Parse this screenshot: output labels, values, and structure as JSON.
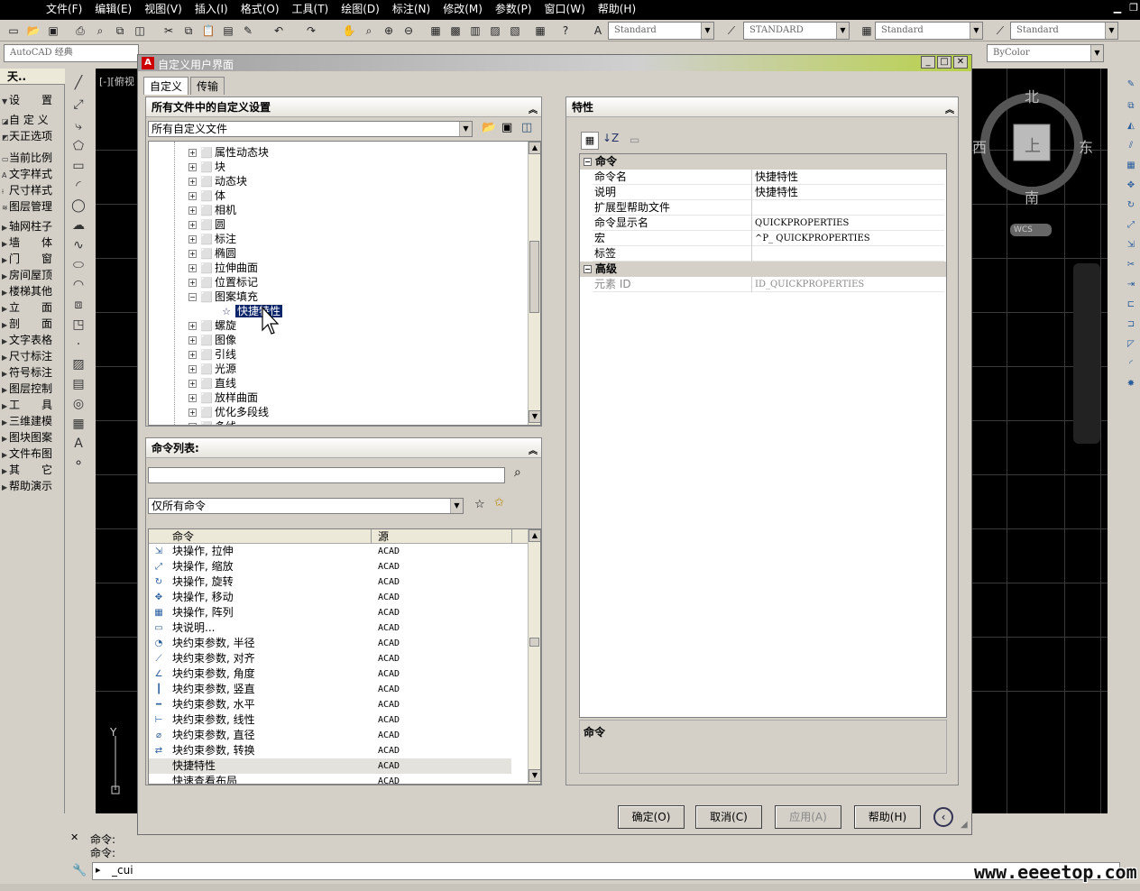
{
  "menubar": {
    "items": [
      "文件(F)",
      "编辑(E)",
      "视图(V)",
      "插入(I)",
      "格式(O)",
      "工具(T)",
      "绘图(D)",
      "标注(N)",
      "修改(M)",
      "参数(P)",
      "窗口(W)",
      "帮助(H)"
    ]
  },
  "toolbar": {
    "text_style": "Standard",
    "dim_style": "STANDARD",
    "table_style": "Standard",
    "multileader_style": "Standard",
    "workspace": "AutoCAD 经典",
    "color": "ByColor"
  },
  "left_panel": {
    "header": "天..",
    "items": [
      "设　　置",
      "自 定 义",
      "天正选项",
      "当前比例",
      "文字样式",
      "尺寸样式",
      "图层管理",
      "轴网柱子",
      "墙　　体",
      "门　　窗",
      "房间屋顶",
      "楼梯其他",
      "立　　面",
      "剖　　面",
      "文字表格",
      "尺寸标注",
      "符号标注",
      "图层控制",
      "工　　具",
      "三维建模",
      "图块图案",
      "文件布图",
      "其　　它",
      "帮助演示"
    ]
  },
  "viewport": {
    "label": "[-][俯视"
  },
  "compass": {
    "north": "北",
    "south": "南",
    "east": "东",
    "west": "西",
    "top": "上",
    "wcs": "WCS"
  },
  "dialog": {
    "title": "自定义用户界面",
    "tabs": [
      "自定义",
      "传输"
    ],
    "customizations_panel": {
      "title": "所有文件中的自定义设置",
      "file_dropdown": "所有自定义文件",
      "tree": [
        "属性动态块",
        "块",
        "动态块",
        "体",
        "相机",
        "圆",
        "标注",
        "椭圆",
        "拉伸曲面",
        "位置标记",
        "图案填充",
        "快捷特性",
        "螺旋",
        "图像",
        "引线",
        "光源",
        "直线",
        "放样曲面",
        "优化多段线",
        "多线"
      ]
    },
    "command_list_panel": {
      "title": "命令列表:",
      "search_value": "",
      "filter": "仅所有命令",
      "columns": [
        "命令",
        "源"
      ],
      "rows": [
        {
          "name": "块操作, 拉伸",
          "source": "ACAD"
        },
        {
          "name": "块操作, 缩放",
          "source": "ACAD"
        },
        {
          "name": "块操作, 旋转",
          "source": "ACAD"
        },
        {
          "name": "块操作, 移动",
          "source": "ACAD"
        },
        {
          "name": "块操作, 阵列",
          "source": "ACAD"
        },
        {
          "name": "块说明...",
          "source": "ACAD"
        },
        {
          "name": "块约束参数, 半径",
          "source": "ACAD"
        },
        {
          "name": "块约束参数, 对齐",
          "source": "ACAD"
        },
        {
          "name": "块约束参数, 角度",
          "source": "ACAD"
        },
        {
          "name": "块约束参数, 竖直",
          "source": "ACAD"
        },
        {
          "name": "块约束参数, 水平",
          "source": "ACAD"
        },
        {
          "name": "块约束参数, 线性",
          "source": "ACAD"
        },
        {
          "name": "块约束参数, 直径",
          "source": "ACAD"
        },
        {
          "name": "块约束参数, 转换",
          "source": "ACAD"
        },
        {
          "name": "快捷特性",
          "source": "ACAD"
        },
        {
          "name": "快速查看布局",
          "source": "ACAD"
        }
      ]
    },
    "properties_panel": {
      "title": "特性",
      "categories": [
        {
          "name": "命令",
          "rows": [
            {
              "key": "命令名",
              "value": "快捷特性"
            },
            {
              "key": "说明",
              "value": "快捷特性"
            },
            {
              "key": "扩展型帮助文件",
              "value": ""
            },
            {
              "key": "命令显示名",
              "value": "QUICKPROPERTIES"
            },
            {
              "key": "宏",
              "value": "^P_ QUICKPROPERTIES"
            },
            {
              "key": "标签",
              "value": ""
            }
          ]
        },
        {
          "name": "高级",
          "rows": [
            {
              "key": "元素 ID",
              "value": "ID_QUICKPROPERTIES"
            }
          ]
        }
      ],
      "description_title": "命令"
    },
    "buttons": {
      "ok": "确定(O)",
      "cancel": "取消(C)",
      "apply": "应用(A)",
      "help": "帮助(H)"
    }
  },
  "command_line": {
    "history1": "命令:",
    "history2": "命令:",
    "input": "_cui"
  },
  "watermark": "www.eeeetop.com"
}
